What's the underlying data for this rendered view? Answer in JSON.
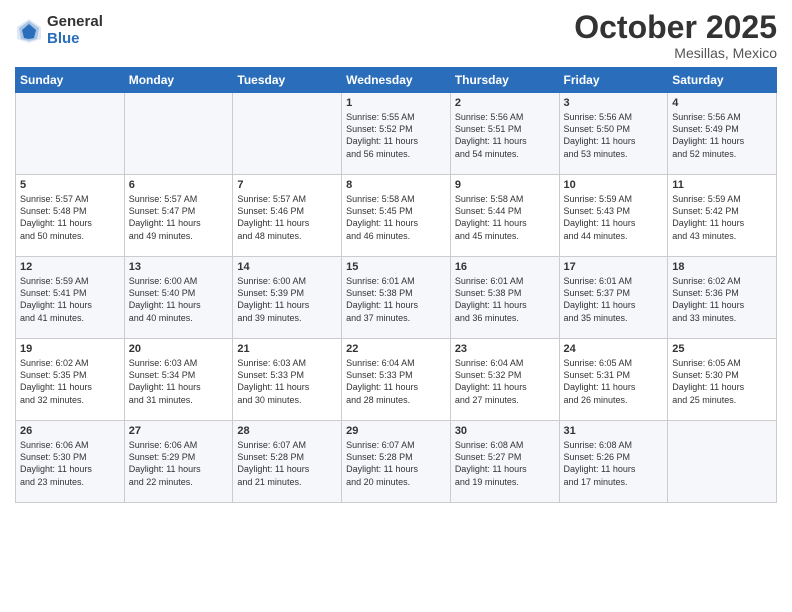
{
  "logo": {
    "general": "General",
    "blue": "Blue"
  },
  "title": "October 2025",
  "location": "Mesillas, Mexico",
  "days_of_week": [
    "Sunday",
    "Monday",
    "Tuesday",
    "Wednesday",
    "Thursday",
    "Friday",
    "Saturday"
  ],
  "weeks": [
    [
      {
        "day": "",
        "info": ""
      },
      {
        "day": "",
        "info": ""
      },
      {
        "day": "",
        "info": ""
      },
      {
        "day": "1",
        "info": "Sunrise: 5:55 AM\nSunset: 5:52 PM\nDaylight: 11 hours\nand 56 minutes."
      },
      {
        "day": "2",
        "info": "Sunrise: 5:56 AM\nSunset: 5:51 PM\nDaylight: 11 hours\nand 54 minutes."
      },
      {
        "day": "3",
        "info": "Sunrise: 5:56 AM\nSunset: 5:50 PM\nDaylight: 11 hours\nand 53 minutes."
      },
      {
        "day": "4",
        "info": "Sunrise: 5:56 AM\nSunset: 5:49 PM\nDaylight: 11 hours\nand 52 minutes."
      }
    ],
    [
      {
        "day": "5",
        "info": "Sunrise: 5:57 AM\nSunset: 5:48 PM\nDaylight: 11 hours\nand 50 minutes."
      },
      {
        "day": "6",
        "info": "Sunrise: 5:57 AM\nSunset: 5:47 PM\nDaylight: 11 hours\nand 49 minutes."
      },
      {
        "day": "7",
        "info": "Sunrise: 5:57 AM\nSunset: 5:46 PM\nDaylight: 11 hours\nand 48 minutes."
      },
      {
        "day": "8",
        "info": "Sunrise: 5:58 AM\nSunset: 5:45 PM\nDaylight: 11 hours\nand 46 minutes."
      },
      {
        "day": "9",
        "info": "Sunrise: 5:58 AM\nSunset: 5:44 PM\nDaylight: 11 hours\nand 45 minutes."
      },
      {
        "day": "10",
        "info": "Sunrise: 5:59 AM\nSunset: 5:43 PM\nDaylight: 11 hours\nand 44 minutes."
      },
      {
        "day": "11",
        "info": "Sunrise: 5:59 AM\nSunset: 5:42 PM\nDaylight: 11 hours\nand 43 minutes."
      }
    ],
    [
      {
        "day": "12",
        "info": "Sunrise: 5:59 AM\nSunset: 5:41 PM\nDaylight: 11 hours\nand 41 minutes."
      },
      {
        "day": "13",
        "info": "Sunrise: 6:00 AM\nSunset: 5:40 PM\nDaylight: 11 hours\nand 40 minutes."
      },
      {
        "day": "14",
        "info": "Sunrise: 6:00 AM\nSunset: 5:39 PM\nDaylight: 11 hours\nand 39 minutes."
      },
      {
        "day": "15",
        "info": "Sunrise: 6:01 AM\nSunset: 5:38 PM\nDaylight: 11 hours\nand 37 minutes."
      },
      {
        "day": "16",
        "info": "Sunrise: 6:01 AM\nSunset: 5:38 PM\nDaylight: 11 hours\nand 36 minutes."
      },
      {
        "day": "17",
        "info": "Sunrise: 6:01 AM\nSunset: 5:37 PM\nDaylight: 11 hours\nand 35 minutes."
      },
      {
        "day": "18",
        "info": "Sunrise: 6:02 AM\nSunset: 5:36 PM\nDaylight: 11 hours\nand 33 minutes."
      }
    ],
    [
      {
        "day": "19",
        "info": "Sunrise: 6:02 AM\nSunset: 5:35 PM\nDaylight: 11 hours\nand 32 minutes."
      },
      {
        "day": "20",
        "info": "Sunrise: 6:03 AM\nSunset: 5:34 PM\nDaylight: 11 hours\nand 31 minutes."
      },
      {
        "day": "21",
        "info": "Sunrise: 6:03 AM\nSunset: 5:33 PM\nDaylight: 11 hours\nand 30 minutes."
      },
      {
        "day": "22",
        "info": "Sunrise: 6:04 AM\nSunset: 5:33 PM\nDaylight: 11 hours\nand 28 minutes."
      },
      {
        "day": "23",
        "info": "Sunrise: 6:04 AM\nSunset: 5:32 PM\nDaylight: 11 hours\nand 27 minutes."
      },
      {
        "day": "24",
        "info": "Sunrise: 6:05 AM\nSunset: 5:31 PM\nDaylight: 11 hours\nand 26 minutes."
      },
      {
        "day": "25",
        "info": "Sunrise: 6:05 AM\nSunset: 5:30 PM\nDaylight: 11 hours\nand 25 minutes."
      }
    ],
    [
      {
        "day": "26",
        "info": "Sunrise: 6:06 AM\nSunset: 5:30 PM\nDaylight: 11 hours\nand 23 minutes."
      },
      {
        "day": "27",
        "info": "Sunrise: 6:06 AM\nSunset: 5:29 PM\nDaylight: 11 hours\nand 22 minutes."
      },
      {
        "day": "28",
        "info": "Sunrise: 6:07 AM\nSunset: 5:28 PM\nDaylight: 11 hours\nand 21 minutes."
      },
      {
        "day": "29",
        "info": "Sunrise: 6:07 AM\nSunset: 5:28 PM\nDaylight: 11 hours\nand 20 minutes."
      },
      {
        "day": "30",
        "info": "Sunrise: 6:08 AM\nSunset: 5:27 PM\nDaylight: 11 hours\nand 19 minutes."
      },
      {
        "day": "31",
        "info": "Sunrise: 6:08 AM\nSunset: 5:26 PM\nDaylight: 11 hours\nand 17 minutes."
      },
      {
        "day": "",
        "info": ""
      }
    ]
  ]
}
